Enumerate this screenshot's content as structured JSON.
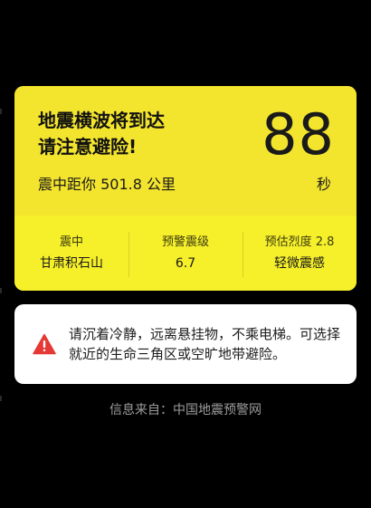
{
  "alert": {
    "headline_line1": "地震横波将到达",
    "headline_line2": "请注意避险!",
    "countdown": "88",
    "countdown_unit": "秒",
    "distance": "震中距你 501.8 公里"
  },
  "stats": [
    {
      "label": "震中",
      "value": "甘肃积石山"
    },
    {
      "label": "预警震级",
      "value": "6.7"
    },
    {
      "label": "预估烈度 2.8",
      "value": "轻微震感"
    }
  ],
  "advice": {
    "icon": "warning-triangle-icon",
    "text": "请沉着冷静，远离悬挂物，不乘电梯。可选择就近的生命三角区或空旷地带避险。"
  },
  "source": "信息来自：中国地震预警网",
  "colors": {
    "alert_top": "#F3E42D",
    "alert_bottom": "#F6F02A",
    "warning_red": "#E53935",
    "background": "#000000"
  }
}
